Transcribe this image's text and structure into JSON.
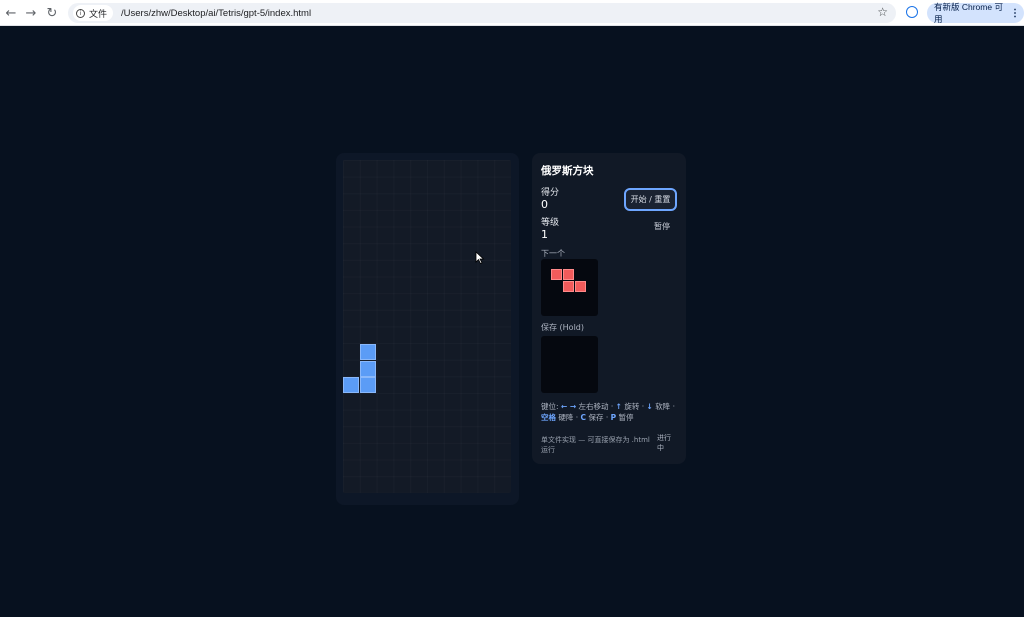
{
  "browser": {
    "site_chip": "文件",
    "url": "/Users/zhw/Desktop/ai/Tetris/gpt-5/index.html",
    "update_button": "有新版 Chrome 可用"
  },
  "game": {
    "title": "俄罗斯方块",
    "score_label": "得分",
    "score_value": "0",
    "level_label": "等级",
    "level_value": "1",
    "start_button": "开始 / 重置",
    "pause_button": "暂停",
    "next_label": "下一个",
    "hold_label": "保存 (Hold)",
    "keys": {
      "prefix": "键位:",
      "left_right_keys": "← →",
      "move": "左右移动",
      "up_key": "↑",
      "rotate": "旋转",
      "down_key": "↓",
      "soft_drop": "软降",
      "space_key": "空格",
      "hard_drop": "硬降",
      "c_key": "C",
      "hold": "保存",
      "p_key": "P",
      "pause": "暂停"
    },
    "footer": "单文件实现 — 可直接保存为 .html 运行",
    "status": "进行中"
  },
  "colors": {
    "background": "#07111f",
    "board": "#131a26",
    "active_piece": "#5b9cf6",
    "next_piece": "#f25b5b",
    "accent": "#6ea6ff"
  },
  "icons": [
    "back-icon",
    "forward-icon",
    "reload-icon",
    "info-icon",
    "star-icon",
    "profile-icon",
    "menu-dots-icon"
  ]
}
